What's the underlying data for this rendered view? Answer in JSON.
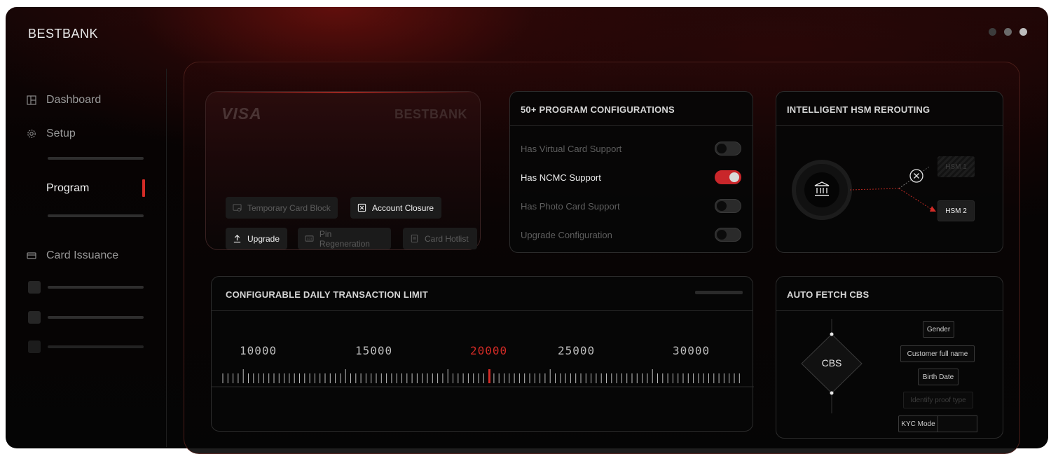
{
  "window": {
    "title": "BESTBANK"
  },
  "sidebar": {
    "dashboard": "Dashboard",
    "setup": "Setup",
    "program": "Program",
    "card_issuance": "Card Issuance"
  },
  "card": {
    "network": "VISA",
    "brand": "BESTBANK",
    "actions": [
      {
        "label": "Temporary Card Block",
        "enabled": false
      },
      {
        "label": "Account Closure",
        "enabled": true
      },
      {
        "label": "Upgrade",
        "enabled": true
      },
      {
        "label": "Pin Regeneration",
        "enabled": false
      },
      {
        "label": "Card Hotlist",
        "enabled": false
      }
    ]
  },
  "program_config": {
    "title": "50+ PROGRAM CONFIGURATIONS",
    "rows": [
      {
        "label": "Has Virtual Card Support",
        "on": false
      },
      {
        "label": "Has NCMC Support",
        "on": true
      },
      {
        "label": "Has Photo Card Support",
        "on": false
      },
      {
        "label": "Upgrade Configuration",
        "on": false
      }
    ]
  },
  "hsm": {
    "title": "INTELLIGENT HSM REROUTING",
    "hsm1": "HSM 1",
    "hsm2": "HSM 2"
  },
  "limit": {
    "title": "CONFIGURABLE DAILY TRANSACTION LIMIT",
    "ticks": [
      "10000",
      "15000",
      "20000",
      "25000",
      "30000"
    ],
    "selected": "20000"
  },
  "cbs": {
    "title": "AUTO FETCH CBS",
    "node": "CBS",
    "fields": [
      "Gender",
      "Customer full name",
      "Birth Date",
      "Identify proof type",
      "KYC Mode"
    ]
  },
  "colors": {
    "accent": "#d22b26",
    "background": "#050505"
  }
}
